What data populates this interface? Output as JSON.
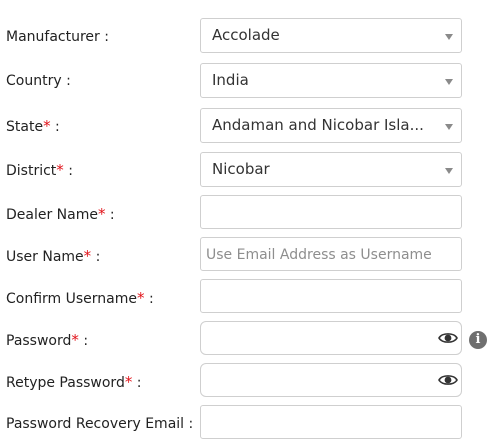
{
  "form": {
    "manufacturer": {
      "label": "Manufacturer :",
      "value": "Accolade"
    },
    "country": {
      "label": "Country :",
      "value": "India"
    },
    "state": {
      "label": "State",
      "required": "*",
      "suffix": " :",
      "value": "Andaman and Nicobar Isla..."
    },
    "district": {
      "label": "District",
      "required": "*",
      "suffix": " :",
      "value": "Nicobar"
    },
    "dealer_name": {
      "label": "Dealer Name",
      "required": "*",
      "suffix": " :",
      "value": ""
    },
    "user_name": {
      "label": "User Name",
      "required": "*",
      "suffix": " :",
      "placeholder": "Use Email Address as Username"
    },
    "confirm_username": {
      "label": "Confirm Username",
      "required": "*",
      "suffix": " :",
      "value": ""
    },
    "password": {
      "label": "Password",
      "required": "*",
      "suffix": " :",
      "value": "",
      "icon": "eye-icon",
      "info_icon": "info-icon",
      "info_glyph": "i"
    },
    "retype_password": {
      "label": "Retype Password",
      "required": "*",
      "suffix": " :",
      "value": "",
      "icon": "eye-icon"
    },
    "recovery_email": {
      "label": "Password Recovery Email :",
      "value": ""
    }
  },
  "colors": {
    "required": "#e1131a",
    "border": "#cfcfcf",
    "placeholder": "#8e8e8e"
  }
}
